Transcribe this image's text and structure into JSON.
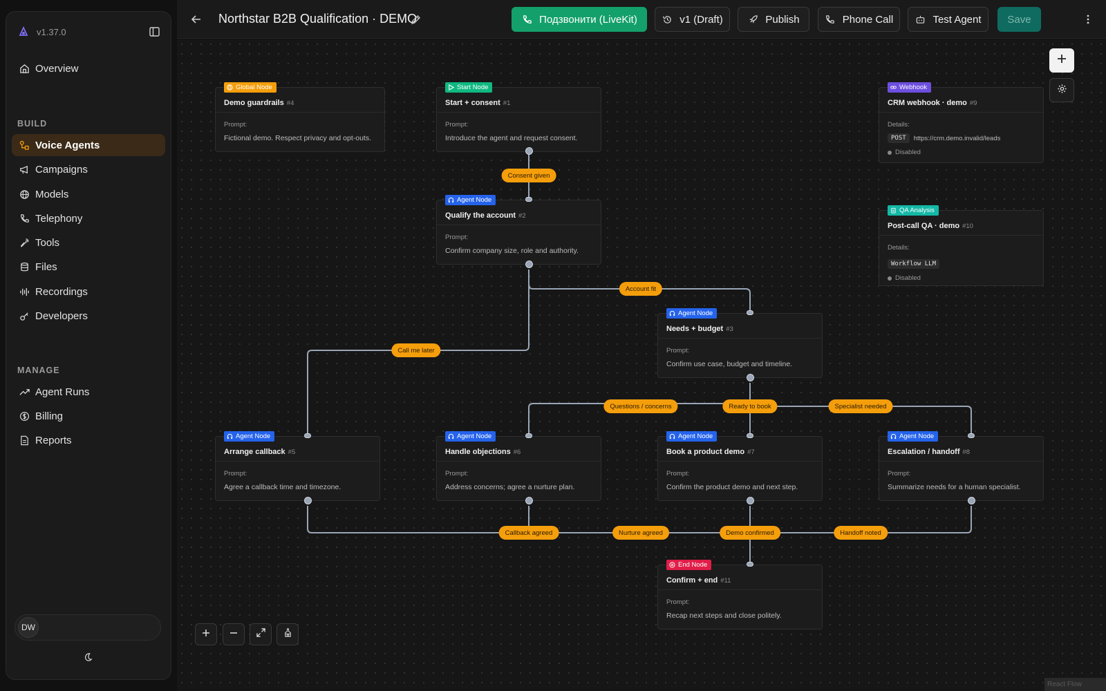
{
  "app": {
    "version": "v1.37.0"
  },
  "sidebar": {
    "overview": "Overview",
    "build_label": "BUILD",
    "build_items": [
      {
        "label": "Voice Agents",
        "icon": "workflow-icon",
        "active": true
      },
      {
        "label": "Campaigns",
        "icon": "megaphone-icon"
      },
      {
        "label": "Models",
        "icon": "globe-icon"
      },
      {
        "label": "Telephony",
        "icon": "phone-icon"
      },
      {
        "label": "Tools",
        "icon": "wrench-icon"
      },
      {
        "label": "Files",
        "icon": "database-icon"
      },
      {
        "label": "Recordings",
        "icon": "waveform-icon"
      },
      {
        "label": "Developers",
        "icon": "key-icon"
      }
    ],
    "manage_label": "MANAGE",
    "manage_items": [
      {
        "label": "Agent Runs",
        "icon": "trend-icon"
      },
      {
        "label": "Billing",
        "icon": "dollar-icon"
      },
      {
        "label": "Reports",
        "icon": "document-icon"
      }
    ],
    "user_initials": "DW"
  },
  "topbar": {
    "title": "Northstar B2B Qualification · DEMO",
    "call_livekit": "Подзвонити (LiveKit)",
    "version_label": "v1 (Draft)",
    "publish": "Publish",
    "phone_call": "Phone Call",
    "test_agent": "Test Agent",
    "save": "Save"
  },
  "nodes": {
    "n4": {
      "type": "Global Node",
      "title": "Demo guardrails",
      "id": "#4",
      "label": "Prompt:",
      "text": "Fictional demo. Respect privacy and opt-outs."
    },
    "n1": {
      "type": "Start Node",
      "title": "Start + consent",
      "id": "#1",
      "label": "Prompt:",
      "text": "Introduce the agent and request consent."
    },
    "n2": {
      "type": "Agent Node",
      "title": "Qualify the account",
      "id": "#2",
      "label": "Prompt:",
      "text": "Confirm company size, role and authority."
    },
    "n3": {
      "type": "Agent Node",
      "title": "Needs + budget",
      "id": "#3",
      "label": "Prompt:",
      "text": "Confirm use case, budget and timeline."
    },
    "n5": {
      "type": "Agent Node",
      "title": "Arrange callback",
      "id": "#5",
      "label": "Prompt:",
      "text": "Agree a callback time and timezone."
    },
    "n6": {
      "type": "Agent Node",
      "title": "Handle objections",
      "id": "#6",
      "label": "Prompt:",
      "text": "Address concerns; agree a nurture plan."
    },
    "n7": {
      "type": "Agent Node",
      "title": "Book a product demo",
      "id": "#7",
      "label": "Prompt:",
      "text": "Confirm the product demo and next step."
    },
    "n8": {
      "type": "Agent Node",
      "title": "Escalation / handoff",
      "id": "#8",
      "label": "Prompt:",
      "text": "Summarize needs for a human specialist."
    },
    "n11": {
      "type": "End Node",
      "title": "Confirm + end",
      "id": "#11",
      "label": "Prompt:",
      "text": "Recap next steps and close politely."
    },
    "n9": {
      "type": "Webhook",
      "title": "CRM webhook · demo",
      "id": "#9",
      "label": "Details:",
      "method": "POST",
      "url": "https://crm.demo.invalid/leads",
      "status": "Disabled"
    },
    "n10": {
      "type": "QA Analysis",
      "title": "Post-call QA · demo",
      "id": "#10",
      "label": "Details:",
      "chip": "Workflow LLM",
      "status": "Disabled"
    }
  },
  "edges": {
    "consent_given": "Consent given",
    "account_fit": "Account fit",
    "call_me_later": "Call me later",
    "questions": "Questions / concerns",
    "ready_to_book": "Ready to book",
    "specialist_needed": "Specialist needed",
    "callback_agreed": "Callback agreed",
    "nurture_agreed": "Nurture agreed",
    "demo_confirmed": "Demo confirmed",
    "handoff_noted": "Handoff noted"
  },
  "colors": {
    "accent": "#14a06b",
    "edge_label": "#f59e0b",
    "global_badge": "#f59e0b",
    "start_badge": "#10b981",
    "agent_badge": "#2563eb",
    "end_badge": "#e11d48",
    "webhook_badge": "#6d4fe0",
    "qa_badge": "#14b8a6"
  },
  "watermark": "React Flow"
}
